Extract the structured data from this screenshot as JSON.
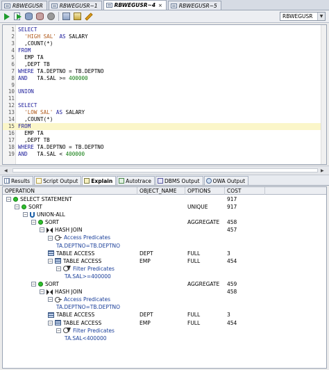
{
  "tabs": [
    {
      "label": "RBWEGUSR",
      "active": false
    },
    {
      "label": "RBWEGUSR~1",
      "active": false
    },
    {
      "label": "RBWEGUSR~4",
      "active": true
    },
    {
      "label": "RBWEGUSR~5",
      "active": false
    }
  ],
  "toolbar": {
    "icons": [
      "run-statement-icon",
      "run-script-icon",
      "commit-icon",
      "rollback-icon",
      "cancel-icon",
      "sql-tuning-icon",
      "explain-plan-icon",
      "clear-icon"
    ],
    "connection": "RBWEGUSR"
  },
  "editor": {
    "lines": [
      {
        "n": "1",
        "text": "SELECT"
      },
      {
        "n": "2",
        "text": "  'HIGH SAL' AS SALARY"
      },
      {
        "n": "3",
        "text": "  ,COUNT(*)"
      },
      {
        "n": "4",
        "text": "FROM"
      },
      {
        "n": "5",
        "text": "  EMP TA"
      },
      {
        "n": "6",
        "text": "  ,DEPT TB"
      },
      {
        "n": "7",
        "text": "WHERE TA.DEPTNO = TB.DEPTNO"
      },
      {
        "n": "8",
        "text": "AND   TA.SAL >= 400000"
      },
      {
        "n": "9",
        "text": ""
      },
      {
        "n": "10",
        "text": "UNION"
      },
      {
        "n": "11",
        "text": ""
      },
      {
        "n": "12",
        "text": "SELECT"
      },
      {
        "n": "13",
        "text": "  'LOW SAL' AS SALARY"
      },
      {
        "n": "14",
        "text": "  ,COUNT(*)"
      },
      {
        "n": "15",
        "text": "FROM"
      },
      {
        "n": "16",
        "text": "  EMP TA"
      },
      {
        "n": "17",
        "text": "  ,DEPT TB"
      },
      {
        "n": "18",
        "text": "WHERE TA.DEPTNO = TB.DEPTNO"
      },
      {
        "n": "19",
        "text": "AND   TA.SAL < 400000"
      }
    ],
    "highlighted_line": "15"
  },
  "output_tabs": [
    {
      "label": "Results",
      "icon": "results-grid-icon",
      "active": false
    },
    {
      "label": "Script Output",
      "icon": "script-output-icon",
      "active": false
    },
    {
      "label": "Explain",
      "icon": "explain-icon",
      "active": true
    },
    {
      "label": "Autotrace",
      "icon": "autotrace-icon",
      "active": false
    },
    {
      "label": "DBMS Output",
      "icon": "dbms-output-icon",
      "active": false
    },
    {
      "label": "OWA Output",
      "icon": "owa-output-icon",
      "active": false
    }
  ],
  "plan": {
    "columns": [
      "OPERATION",
      "OBJECT_NAME",
      "OPTIONS",
      "COST"
    ],
    "rows": [
      {
        "depth": 0,
        "icon": "green-dot",
        "expander": "-",
        "operation": "SELECT STATEMENT",
        "object": "",
        "options": "",
        "cost": "917"
      },
      {
        "depth": 1,
        "icon": "green-dot",
        "expander": "-",
        "operation": "SORT",
        "object": "",
        "options": "UNIQUE",
        "cost": "917"
      },
      {
        "depth": 2,
        "icon": "union",
        "expander": "-",
        "operation": "UNION-ALL",
        "object": "",
        "options": "",
        "cost": ""
      },
      {
        "depth": 3,
        "icon": "green-dot",
        "expander": "-",
        "operation": "SORT",
        "object": "",
        "options": "AGGREGATE",
        "cost": "458"
      },
      {
        "depth": 4,
        "icon": "hash-join",
        "expander": "-",
        "operation": "HASH JOIN",
        "object": "",
        "options": "",
        "cost": "457"
      },
      {
        "depth": 5,
        "icon": "access-pred",
        "expander": "-",
        "operation": "Access Predicates",
        "object": "",
        "options": "",
        "cost": "",
        "predicate": true
      },
      {
        "depth": 6,
        "icon": "none",
        "expander": "",
        "operation": "TA.DEPTNO=TB.DEPTNO",
        "object": "",
        "options": "",
        "cost": "",
        "value": true
      },
      {
        "depth": 5,
        "icon": "table",
        "expander": "",
        "operation": "TABLE ACCESS",
        "object": "DEPT",
        "options": "FULL",
        "cost": "3"
      },
      {
        "depth": 5,
        "icon": "table",
        "expander": "-",
        "operation": "TABLE ACCESS",
        "object": "EMP",
        "options": "FULL",
        "cost": "454"
      },
      {
        "depth": 6,
        "icon": "filter-pred",
        "expander": "-",
        "operation": "Filter Predicates",
        "object": "",
        "options": "",
        "cost": "",
        "predicate": true
      },
      {
        "depth": 7,
        "icon": "none",
        "expander": "",
        "operation": "TA.SAL>=400000",
        "object": "",
        "options": "",
        "cost": "",
        "value": true
      },
      {
        "depth": 3,
        "icon": "green-dot",
        "expander": "-",
        "operation": "SORT",
        "object": "",
        "options": "AGGREGATE",
        "cost": "459"
      },
      {
        "depth": 4,
        "icon": "hash-join",
        "expander": "-",
        "operation": "HASH JOIN",
        "object": "",
        "options": "",
        "cost": "458"
      },
      {
        "depth": 5,
        "icon": "access-pred",
        "expander": "-",
        "operation": "Access Predicates",
        "object": "",
        "options": "",
        "cost": "",
        "predicate": true
      },
      {
        "depth": 6,
        "icon": "none",
        "expander": "",
        "operation": "TA.DEPTNO=TB.DEPTNO",
        "object": "",
        "options": "",
        "cost": "",
        "value": true
      },
      {
        "depth": 5,
        "icon": "table",
        "expander": "",
        "operation": "TABLE ACCESS",
        "object": "DEPT",
        "options": "FULL",
        "cost": "3"
      },
      {
        "depth": 5,
        "icon": "table",
        "expander": "-",
        "operation": "TABLE ACCESS",
        "object": "EMP",
        "options": "FULL",
        "cost": "454"
      },
      {
        "depth": 6,
        "icon": "filter-pred",
        "expander": "-",
        "operation": "Filter Predicates",
        "object": "",
        "options": "",
        "cost": "",
        "predicate": true
      },
      {
        "depth": 7,
        "icon": "none",
        "expander": "",
        "operation": "TA.SAL<400000",
        "object": "",
        "options": "",
        "cost": "",
        "value": true
      }
    ]
  }
}
